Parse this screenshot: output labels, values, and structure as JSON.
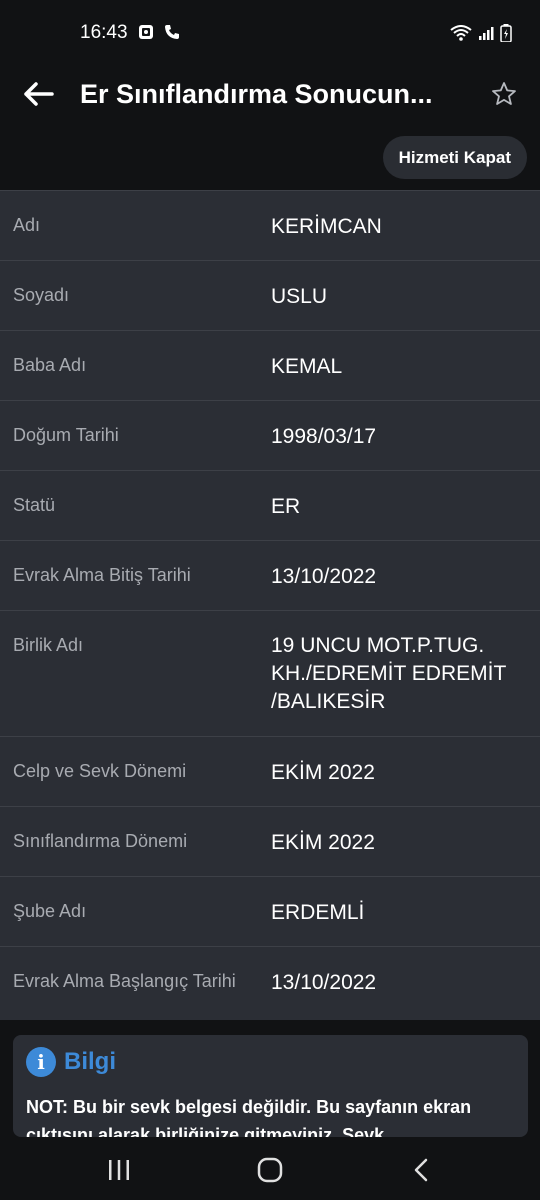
{
  "status_bar": {
    "time": "16:43",
    "icons": [
      "screenshot-icon",
      "phone-icon",
      "wifi-icon",
      "signal-icon",
      "battery-icon"
    ]
  },
  "app_bar": {
    "title": "Er Sınıflandırma Sonucun..."
  },
  "actions": {
    "close_service_label": "Hizmeti Kapat"
  },
  "info_table": {
    "rows": [
      {
        "label": "Adı",
        "value": "KERİMCAN"
      },
      {
        "label": "Soyadı",
        "value": "USLU"
      },
      {
        "label": "Baba Adı",
        "value": "KEMAL"
      },
      {
        "label": "Doğum Tarihi",
        "value": "1998/03/17"
      },
      {
        "label": "Statü",
        "value": "ER"
      },
      {
        "label": "Evrak Alma Bitiş Tarihi",
        "value": "13/10/2022"
      },
      {
        "label": "Birlik Adı",
        "value": "19 UNCU MOT.P.TUG. KH./EDREMİT EDREMİT /BALIKESİR"
      },
      {
        "label": "Celp ve Sevk Dönemi",
        "value": "EKİM 2022"
      },
      {
        "label": "Sınıflandırma Dönemi",
        "value": "EKİM 2022"
      },
      {
        "label": "Şube Adı",
        "value": "ERDEMLİ"
      },
      {
        "label": "Evrak Alma Başlangıç Tarihi",
        "value": "13/10/2022"
      }
    ]
  },
  "info_card": {
    "icon_letter": "i",
    "title": "Bilgi",
    "text": "NOT: Bu bir sevk belgesi değildir. Bu sayfanın ekran çıktısını alarak birliğinize gitmeyiniz. Sevk"
  },
  "colors": {
    "background": "#111214",
    "panel": "#2b2e35",
    "accent_blue": "#3d8ad8",
    "label_gray": "#a8abb1"
  }
}
